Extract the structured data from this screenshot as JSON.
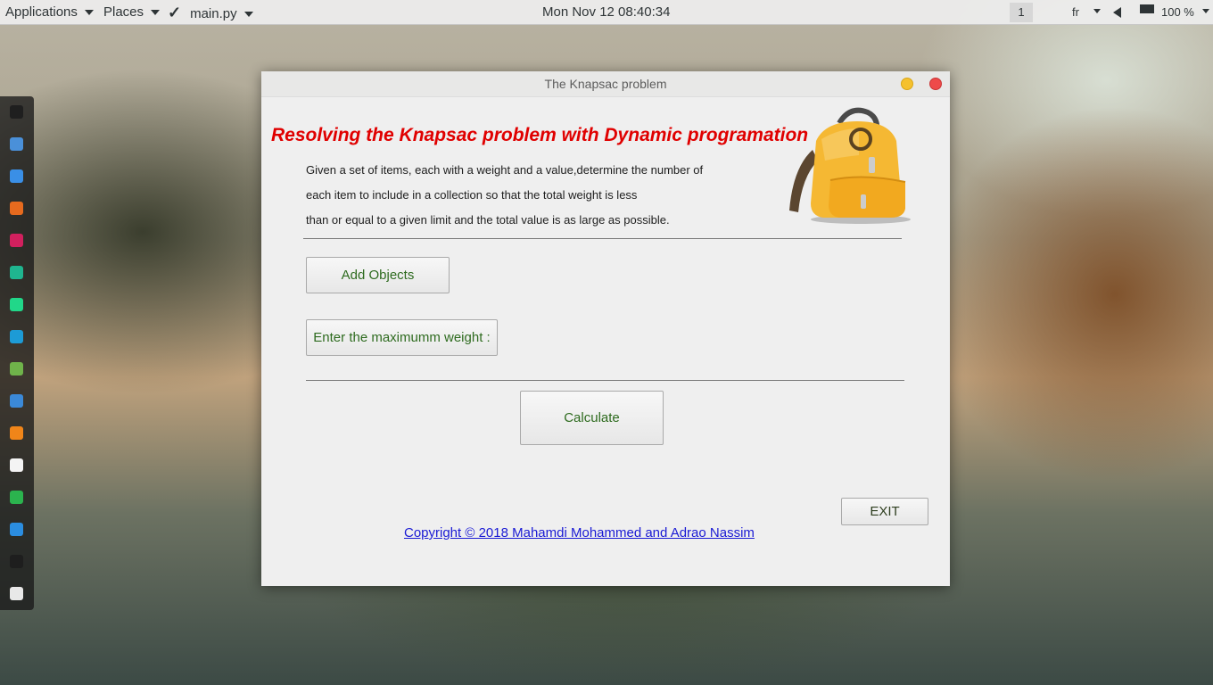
{
  "top_panel": {
    "applications": "Applications",
    "places": "Places",
    "active_app": "main.py",
    "clock": "Mon Nov 12  08:40:34",
    "workspace": "1",
    "keyboard_layout": "fr",
    "battery": "100 %"
  },
  "dock": {
    "items": [
      {
        "icon": "terminal-icon",
        "color": "#1f1f1f"
      },
      {
        "icon": "finder-icon",
        "color": "#4a90d9"
      },
      {
        "icon": "safari-icon",
        "color": "#3a8fe6"
      },
      {
        "icon": "firefox-icon",
        "color": "#e66a1e"
      },
      {
        "icon": "intellij-icon",
        "color": "#d1205e"
      },
      {
        "icon": "clion-icon",
        "color": "#1fb58f"
      },
      {
        "icon": "pycharm-icon",
        "color": "#21d789"
      },
      {
        "icon": "webstorm-icon",
        "color": "#1d9bd6"
      },
      {
        "icon": "android-studio-icon",
        "color": "#6fb34a"
      },
      {
        "icon": "network-icon",
        "color": "#3b89d8"
      },
      {
        "icon": "vlc-icon",
        "color": "#f08519"
      },
      {
        "icon": "document-icon",
        "color": "#f4f4f4"
      },
      {
        "icon": "download-icon",
        "color": "#2bb34e"
      },
      {
        "icon": "tex-icon",
        "color": "#2b8de0"
      },
      {
        "icon": "checkmark-icon",
        "color": "#1e1e1e"
      },
      {
        "icon": "app-grid-icon",
        "color": "#e8e8e8"
      }
    ]
  },
  "window": {
    "title": "The Knapsac problem",
    "heading": "Resolving the Knapsac problem with Dynamic programation",
    "description": [
      "Given a set of items, each with a weight and a value,determine the number of",
      "each item to include in a collection so that the total weight is less",
      "than or equal to a given limit and the total value is as large as possible."
    ],
    "add_objects_label": "Add Objects",
    "max_weight_label": "Enter the maximumm weight :",
    "calculate_label": "Calculate",
    "exit_label": "EXIT",
    "copyright": "Copyright © 2018 Mahamdi Mohammed and Adrao Nassim"
  },
  "colors": {
    "heading": "#e00000",
    "button_text": "#2e6b1f",
    "link": "#1a1ad4",
    "backpack": "#f5b833"
  }
}
